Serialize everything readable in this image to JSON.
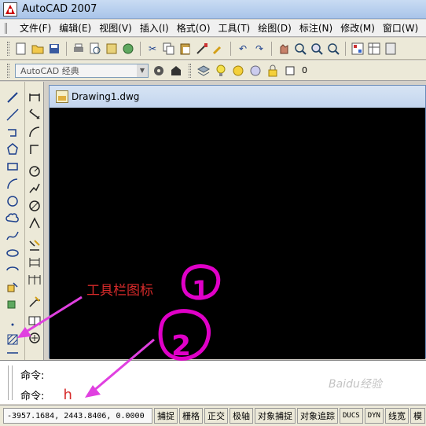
{
  "app": {
    "title": "AutoCAD 2007"
  },
  "menu": {
    "items": [
      "文件(F)",
      "编辑(E)",
      "视图(V)",
      "插入(I)",
      "格式(O)",
      "工具(T)",
      "绘图(D)",
      "标注(N)",
      "修改(M)",
      "窗口(W)"
    ]
  },
  "toolbar2": {
    "workspace": "AutoCAD 经典",
    "layer_value": "0"
  },
  "document": {
    "title": "Drawing1.dwg"
  },
  "annotation": {
    "label": "工具栏图标",
    "marks": [
      "1",
      "2"
    ],
    "colors": {
      "text": "#d62a2a",
      "circle": "#e000c8",
      "arrow": "#e040e0"
    }
  },
  "command": {
    "line1_prompt": "命令:",
    "line2_prompt": "命令:",
    "line2_input": "h"
  },
  "status": {
    "coords": "-3957.1684, 2443.8406, 0.0000",
    "buttons": [
      "捕捉",
      "栅格",
      "正交",
      "极轴",
      "对象捕捉",
      "对象追踪",
      "DUCS",
      "DYN",
      "线宽",
      "模"
    ]
  },
  "watermark": "Baidu经验"
}
